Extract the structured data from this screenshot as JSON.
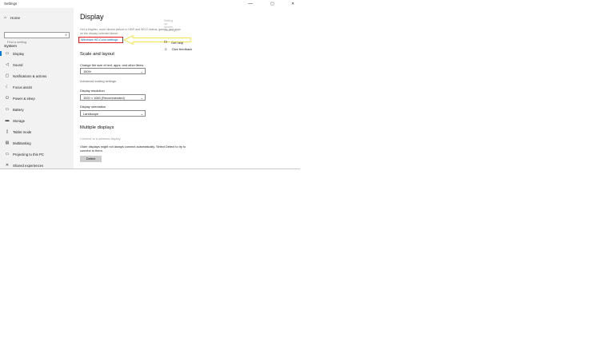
{
  "window": {
    "title": "Settings",
    "minimize": "—",
    "maximize": "▢",
    "close": "✕"
  },
  "sidebar": {
    "home_label": "Home",
    "search_placeholder": "Find a setting",
    "section_label": "System",
    "items": [
      {
        "label": "Display",
        "icon": "display-icon",
        "glyph": "▭"
      },
      {
        "label": "Sound",
        "icon": "sound-icon",
        "glyph": "◁"
      },
      {
        "label": "Notifications & actions",
        "icon": "notifications-icon",
        "glyph": "▢"
      },
      {
        "label": "Focus assist",
        "icon": "focus-assist-icon",
        "glyph": "☾"
      },
      {
        "label": "Power & sleep",
        "icon": "power-icon",
        "glyph": "⏻"
      },
      {
        "label": "Battery",
        "icon": "battery-icon",
        "glyph": "▭"
      },
      {
        "label": "Storage",
        "icon": "storage-icon",
        "glyph": "▬"
      },
      {
        "label": "Tablet mode",
        "icon": "tablet-icon",
        "glyph": "▯"
      },
      {
        "label": "Multitasking",
        "icon": "multitasking-icon",
        "glyph": "▤"
      },
      {
        "label": "Projecting to this PC",
        "icon": "projecting-icon",
        "glyph": "▭"
      },
      {
        "label": "Shared experiences",
        "icon": "shared-experiences-icon",
        "glyph": "✕"
      }
    ]
  },
  "main": {
    "title": "Display",
    "hdr_description": "Get a brighter, more vibrant picture in HDR and WCG videos, games, and apps on the display selected above.",
    "wcg_link": "Windows HD Color settings",
    "scale_header": "Scale and layout",
    "text_size_label": "Change the size of text, apps, and other items",
    "text_size_value": "150%",
    "advanced_scaling": "Advanced scaling settings",
    "resolution_label": "Display resolution",
    "resolution_value": "1920 × 1080 (Recommended)",
    "orientation_label": "Display orientation",
    "orientation_value": "Landscape",
    "multiple_header": "Multiple displays",
    "wireless_link": "Connect to a wireless display",
    "detect_desc": "Older displays might not always connect automatically. Select Detect to try to connect to them.",
    "detect_button": "Detect"
  },
  "right": {
    "faded_line": "Setting up screen flickering",
    "help": "Get help",
    "feedback": "Give feedback"
  },
  "colors": {
    "accent": "#0078d7",
    "highlight_box": "#e02020",
    "arrow": "#f2e64b"
  }
}
